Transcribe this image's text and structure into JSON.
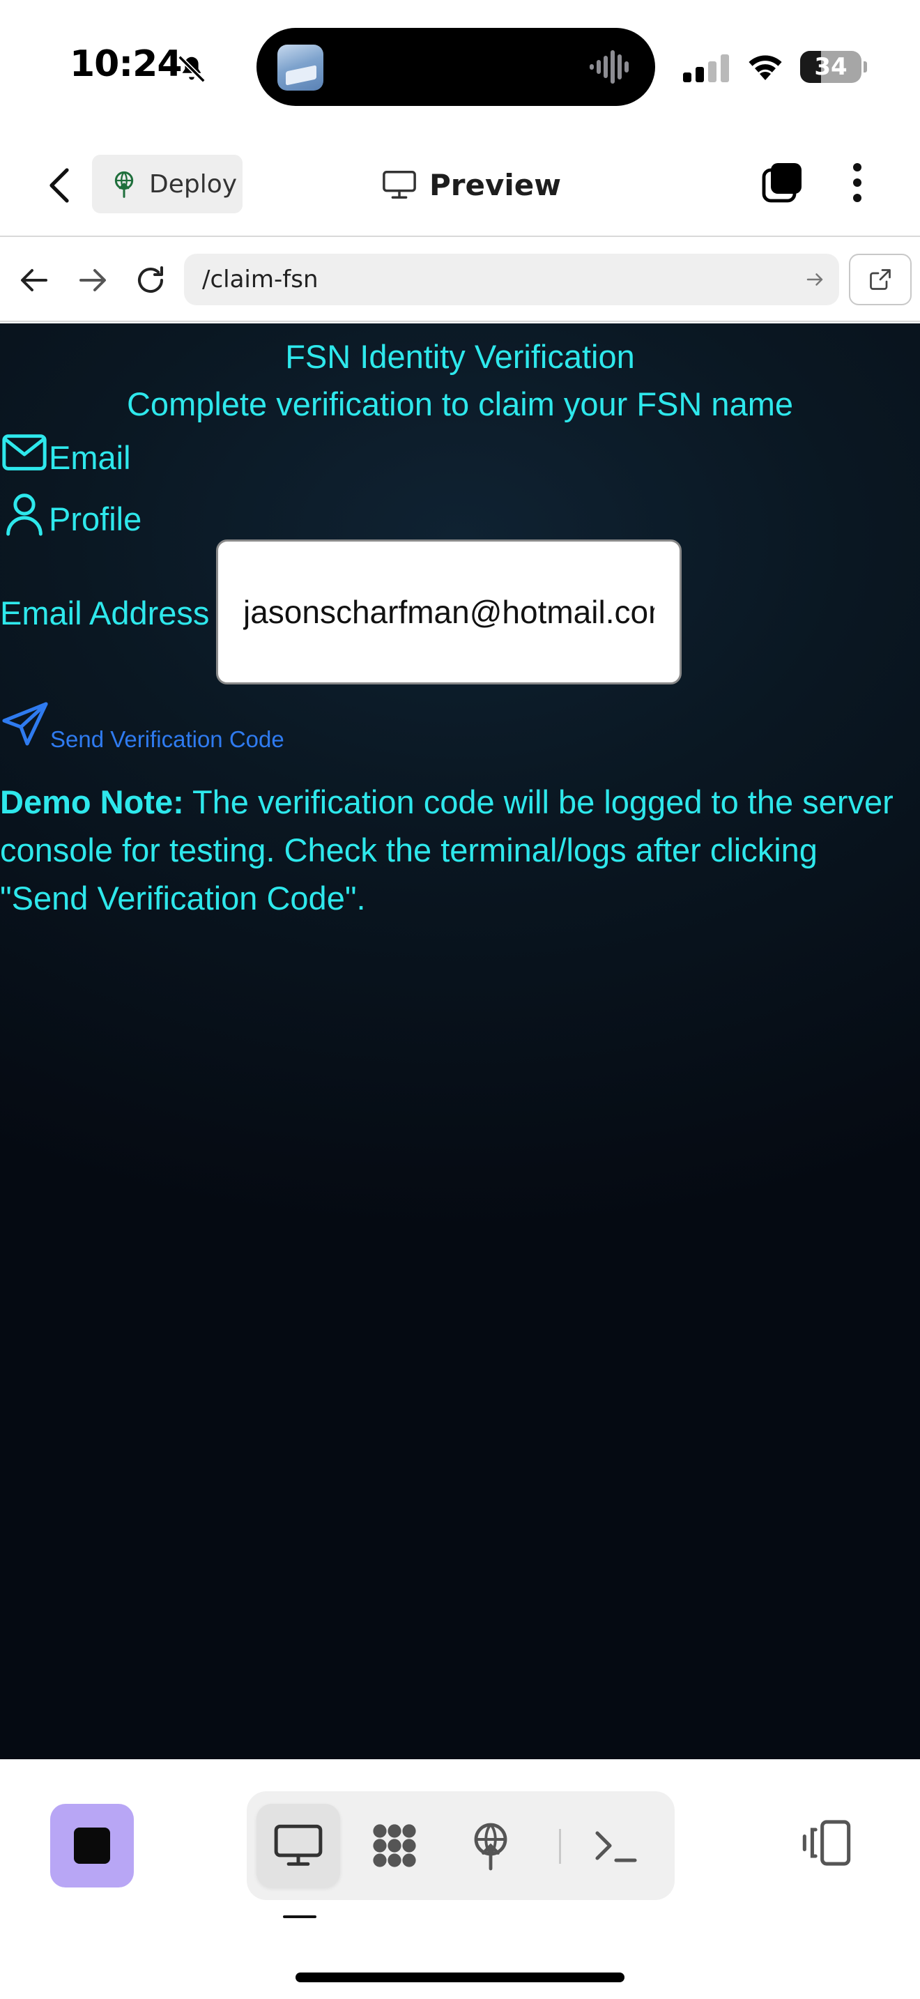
{
  "status_bar": {
    "time": "10:24",
    "battery_level": "34",
    "battery_fraction": 0.34
  },
  "header": {
    "deploy_label": "Deploy",
    "preview_label": "Preview",
    "icons": [
      "chevron-left-icon",
      "deploy-icon",
      "monitor-icon",
      "tabs-icon",
      "more-vertical-icon"
    ]
  },
  "url_bar": {
    "path": "/claim-fsn",
    "icons": [
      "arrow-left-icon",
      "arrow-right-icon",
      "reload-icon",
      "go-arrow-icon",
      "external-link-icon"
    ]
  },
  "page": {
    "title": "FSN Identity Verification",
    "subtitle": "Complete verification to claim your FSN name",
    "tabs": [
      {
        "label": "Email",
        "icon": "mail-icon"
      },
      {
        "label": "Profile",
        "icon": "user-icon"
      }
    ],
    "email_label": "Email Address",
    "email_value": "jasonscharfman@hotmail.com",
    "send_button_label": "Send Verification Code",
    "demo_note_label": "Demo Note:",
    "demo_note_text": " The verification code will be logged to the server console for testing. Check the terminal/logs after clicking \"Send Verification Code\"."
  },
  "colors": {
    "accent_cyan": "#2ee8ec",
    "link_blue": "#2f7bf0",
    "stop_button": "#b8a6f5",
    "background_dark": "#050a12"
  },
  "bottom_bar": {
    "tools": [
      "monitor-icon",
      "grid-dots-icon",
      "deploy-icon",
      "terminal-icon"
    ],
    "active_tool": "monitor-icon"
  }
}
